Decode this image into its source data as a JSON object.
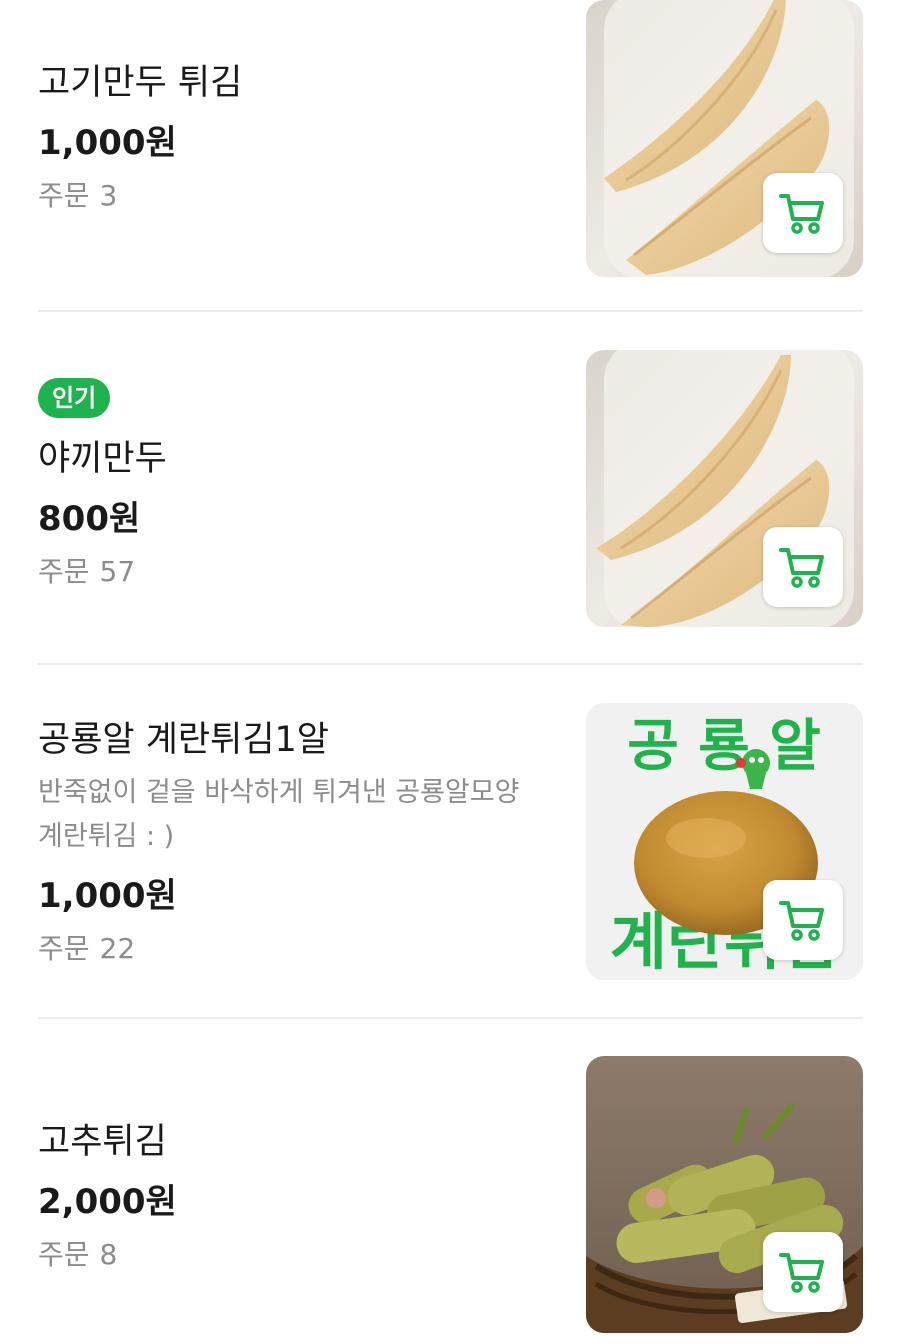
{
  "accent_color": "#1fb34f",
  "items": [
    {
      "name": "고기만두 튀김",
      "badge": "",
      "description": "",
      "price": "1,000원",
      "orders_label": "주문",
      "orders_count": "3",
      "image": "fried-dumpling-photo"
    },
    {
      "name": "야끼만두",
      "badge": "인기",
      "description": "",
      "price": "800원",
      "orders_label": "주문",
      "orders_count": "57",
      "image": "fried-dumpling-photo"
    },
    {
      "name": "공룡알 계란튀김1알",
      "badge": "",
      "description": "반죽없이 겉을 바삭하게 튀겨낸 공룡알모양 계란튀김 : )",
      "price": "1,000원",
      "orders_label": "주문",
      "orders_count": "22",
      "image": "fried-egg-poster",
      "image_text_top": "공 룡 알",
      "image_text_bottom": "계란튀김"
    },
    {
      "name": "고추튀김",
      "badge": "",
      "description": "",
      "price": "2,000원",
      "orders_label": "주문",
      "orders_count": "8",
      "image": "fried-pepper-photo"
    }
  ],
  "icons": {
    "cart": "shopping-cart-icon"
  }
}
